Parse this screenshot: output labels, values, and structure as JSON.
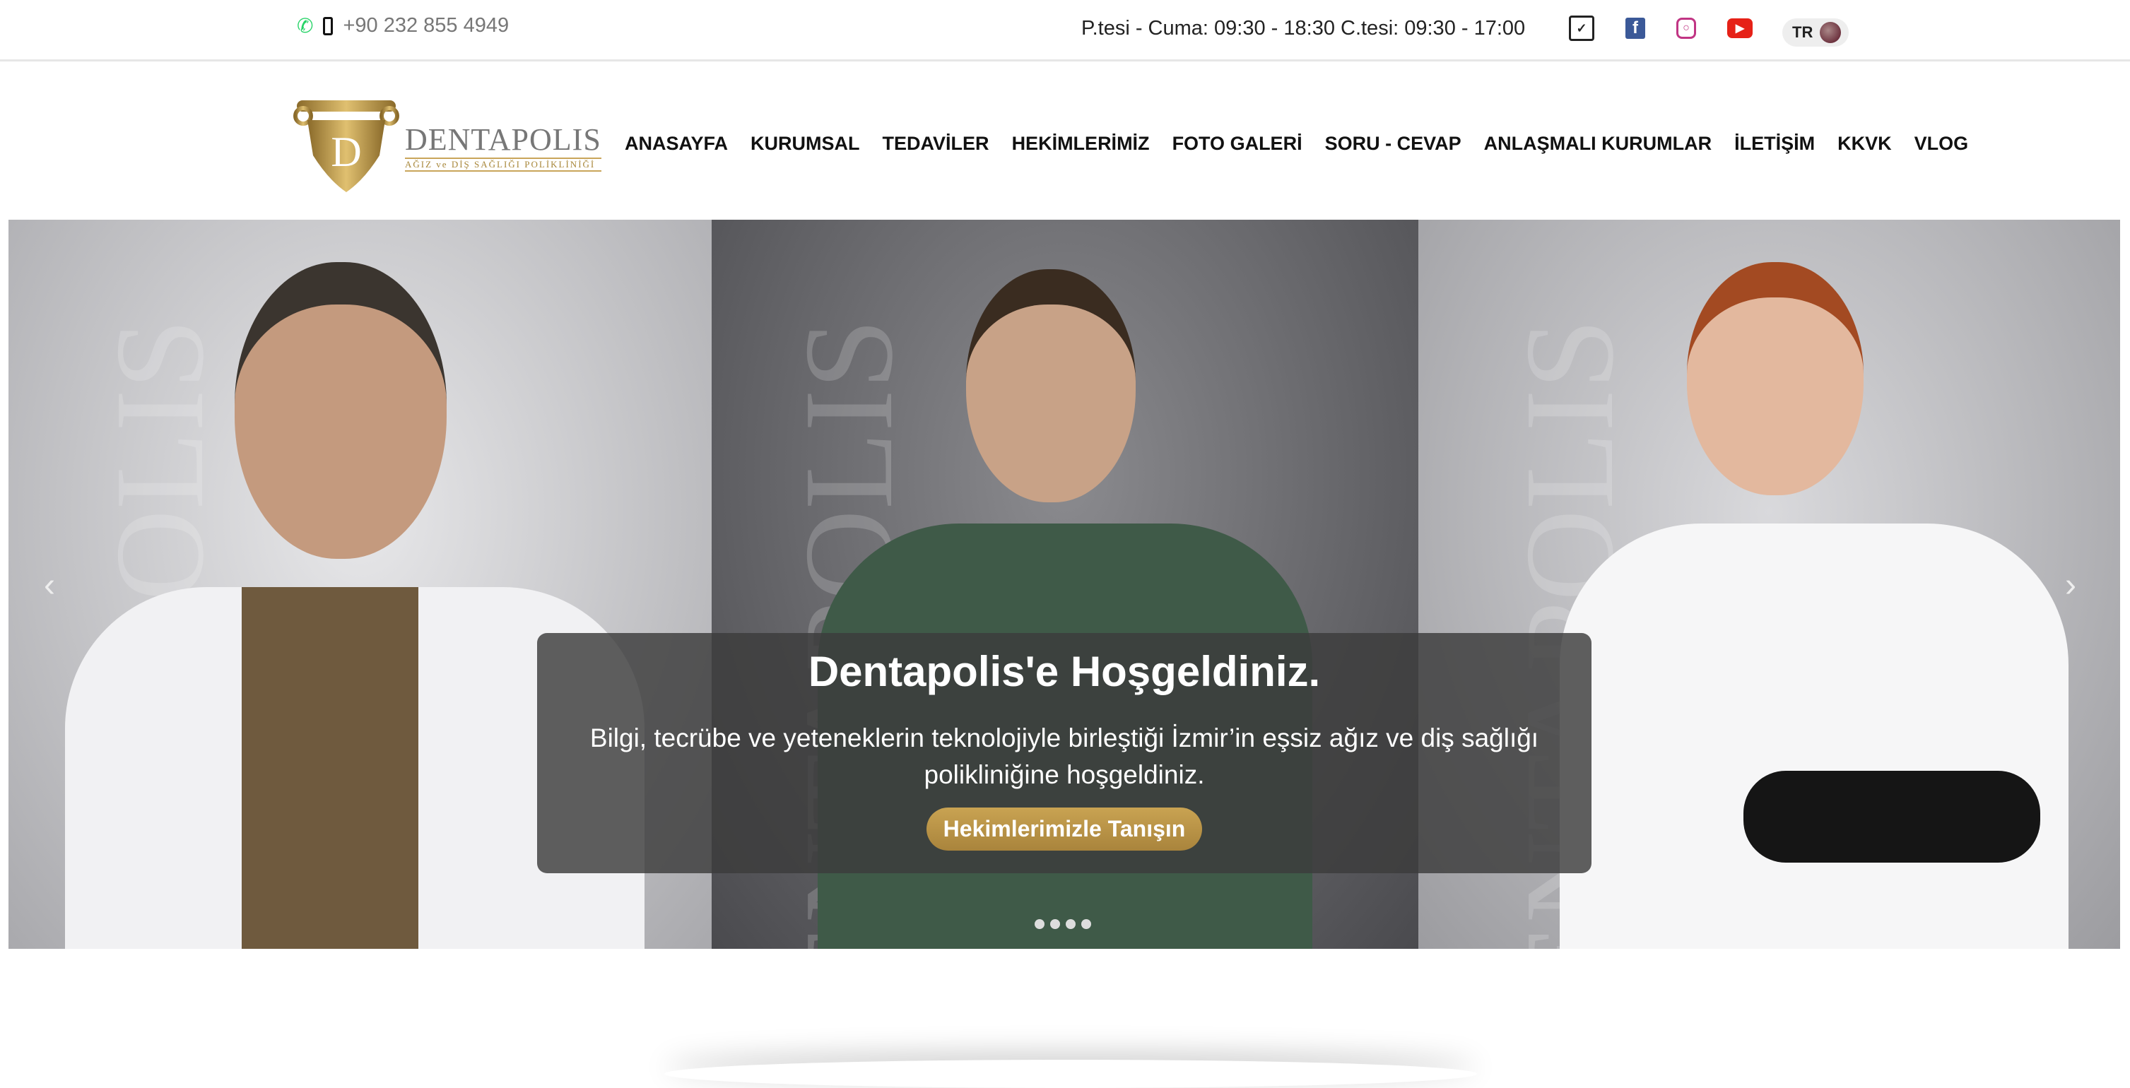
{
  "topbar": {
    "phone": "+90 232 855 4949",
    "hours": "P.tesi - Cuma: 09:30 - 18:30 C.tesi: 09:30 - 17:00",
    "icons": [
      "whatsapp-icon",
      "mobile-phone-icon",
      "mail-icon",
      "facebook-icon",
      "instagram-icon",
      "youtube-icon"
    ],
    "lang": "TR"
  },
  "logo": {
    "brand": "DENTAPOLIS",
    "tagline": "AĞIZ ve DİŞ SAĞLIĞI POLİKLİNİĞİ",
    "letter": "D"
  },
  "nav": [
    "ANASAYFA",
    "KURUMSAL",
    "TEDAVİLER",
    "HEKİMLERİMİZ",
    "FOTO GALERİ",
    "SORU - CEVAP",
    "ANLAŞMALI KURUMLAR",
    "İLETİŞİM",
    "KKVK",
    "VLOG"
  ],
  "hero": {
    "title": "Dentapolis'e Hoşgeldiniz.",
    "subtitle": "Bilgi, tecrübe ve yeteneklerin teknolojiyle birleştiği İzmir’in eşsiz ağız ve diş sağlığı polikliniğine hoşgeldiniz.",
    "button": "Hekimlerimizle Tanışın",
    "slides": 4,
    "watermark": "DENTAPOLIS"
  },
  "colors": {
    "gold": "#b8913f",
    "whatsapp": "#25d366",
    "facebook": "#3b5998",
    "instagram": "#c13584",
    "youtube": "#e62117"
  }
}
